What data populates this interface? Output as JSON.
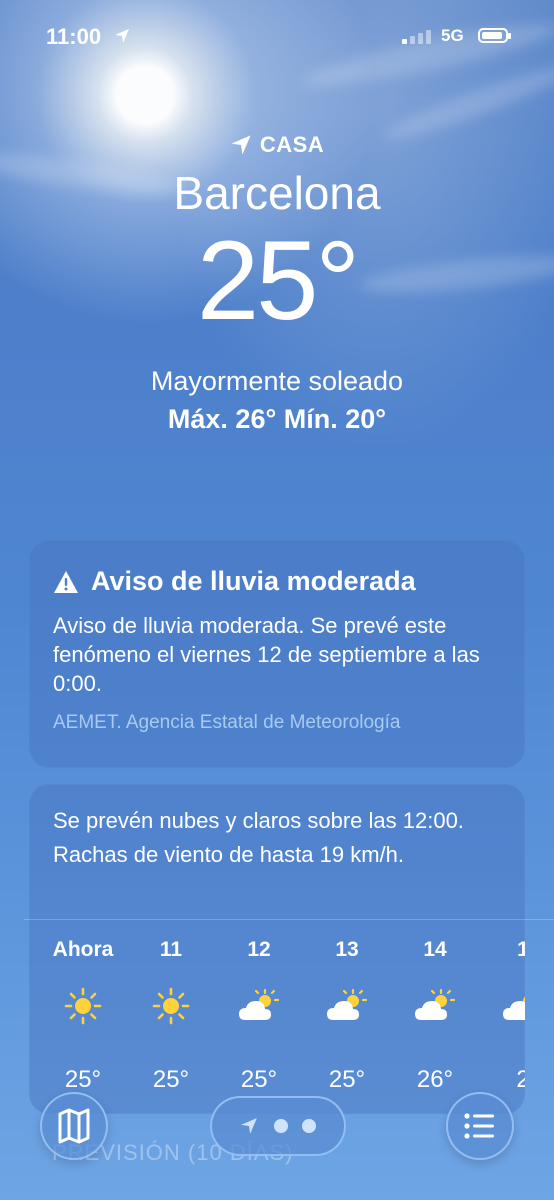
{
  "status_bar": {
    "time": "11:00",
    "network": "5G"
  },
  "location": {
    "home_label": "CASA",
    "city": "Barcelona",
    "temperature": "25°",
    "condition": "Mayormente soleado",
    "hi_lo": "Máx. 26°  Mín. 20°"
  },
  "alert": {
    "title": "Aviso de lluvia moderada",
    "body": "Aviso de lluvia moderada. Se prevé este fenómeno el viernes 12 de septiembre a las 0:00.",
    "source": "AEMET. Agencia Estatal de Meteorología"
  },
  "hourly": {
    "summary": "Se prevén nubes y claros sobre las 12:00. Rachas de viento de hasta 19 km/h.",
    "hours": [
      {
        "label": "Ahora",
        "icon": "sun-icon",
        "temp": "25°"
      },
      {
        "label": "11",
        "icon": "sun-icon",
        "temp": "25°"
      },
      {
        "label": "12",
        "icon": "partly-cloudy-icon",
        "temp": "25°"
      },
      {
        "label": "13",
        "icon": "partly-cloudy-icon",
        "temp": "25°"
      },
      {
        "label": "14",
        "icon": "partly-cloudy-icon",
        "temp": "26°"
      },
      {
        "label": "1",
        "icon": "partly-cloudy-icon",
        "temp": "2"
      }
    ]
  },
  "forecast_peek": "PREVISIÓN (10 DÍAS)",
  "colors": {
    "alert_source": "#a8c9f2",
    "sun": "#ffd23a"
  }
}
